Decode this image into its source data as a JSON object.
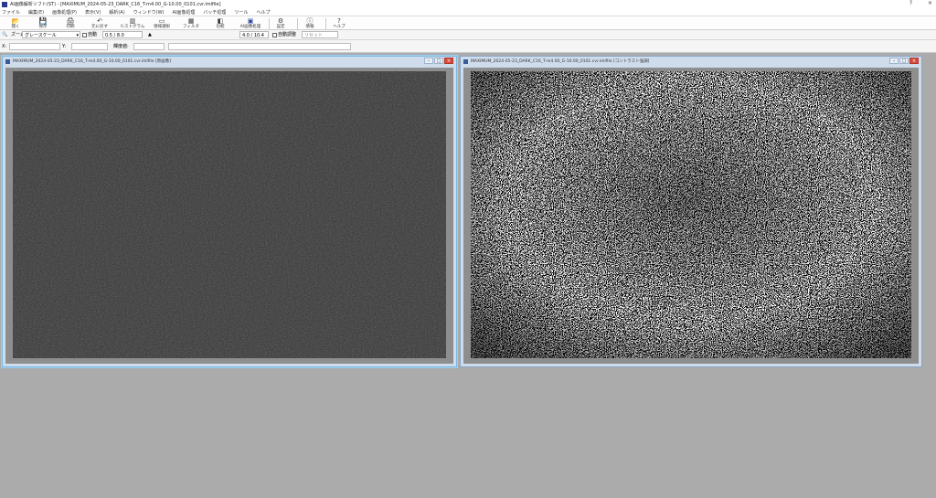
{
  "window": {
    "title": "AI画像解析ソフト(ST) - [MAXIMUM_2024-05-23_DARK_C16_T-m4.00_G-10.00_0101.cvr.imlfile]",
    "help_glyph": "?",
    "close_glyph": "×"
  },
  "menu": [
    "ファイル",
    "編集(E)",
    "画像処理(P)",
    "表示(V)",
    "解析(A)",
    "ウィンドウ(W)",
    "AI画像処理",
    "バッチ処理",
    "ツール",
    "ヘルプ"
  ],
  "toolbar": {
    "buttons": [
      {
        "label": "開く",
        "icon": "📂"
      },
      {
        "label": "保存",
        "icon": "💾"
      },
      {
        "label": "印刷",
        "icon": "🖨"
      },
      {
        "label": "元に戻す",
        "icon": "↶"
      },
      {
        "label": "ヒストグラム",
        "icon": "▥"
      },
      {
        "label": "領域選択",
        "icon": "▭"
      },
      {
        "label": "フィルタ",
        "icon": "▦"
      },
      {
        "label": "比較",
        "icon": "◧"
      },
      {
        "label": "AI画像処理",
        "icon": "▣"
      },
      {
        "label": "設定",
        "icon": "⚙"
      },
      {
        "label": "情報",
        "icon": "ⓘ"
      },
      {
        "label": "ヘルプ",
        "icon": "?"
      }
    ]
  },
  "toolbar2": {
    "zoom_label": "ズーム",
    "colormap": "グレースケール",
    "auto_label": "自動",
    "level_value": "0.5 / 8.0",
    "range_value": "4.0 / 10.4",
    "contrast_label": "自動調整",
    "reset_label": "リセット"
  },
  "toolbar3": {
    "x_label": "X:",
    "y_label": "Y:",
    "value_label": "輝度値:"
  },
  "images": [
    {
      "title": "MAXIMUM_2024-05-23_DARK_C16_T-m4.00_G-10.00_0101.cvr.imlfile [原画像]",
      "min_glyph": "–",
      "max_glyph": "□",
      "close_glyph": "×",
      "style": "dark"
    },
    {
      "title": "MAXIMUM_2024-05-23_DARK_C16_T-m4.00_G-10.00_0101.cvr.imlfile [コントラスト強調]",
      "min_glyph": "–",
      "max_glyph": "□",
      "close_glyph": "×",
      "style": "noise"
    }
  ],
  "colors": {
    "workspace": "#ababab",
    "child_frame": "#cfdcec",
    "image_border": "#8e8e8e",
    "close_red": "#d84a3a"
  }
}
